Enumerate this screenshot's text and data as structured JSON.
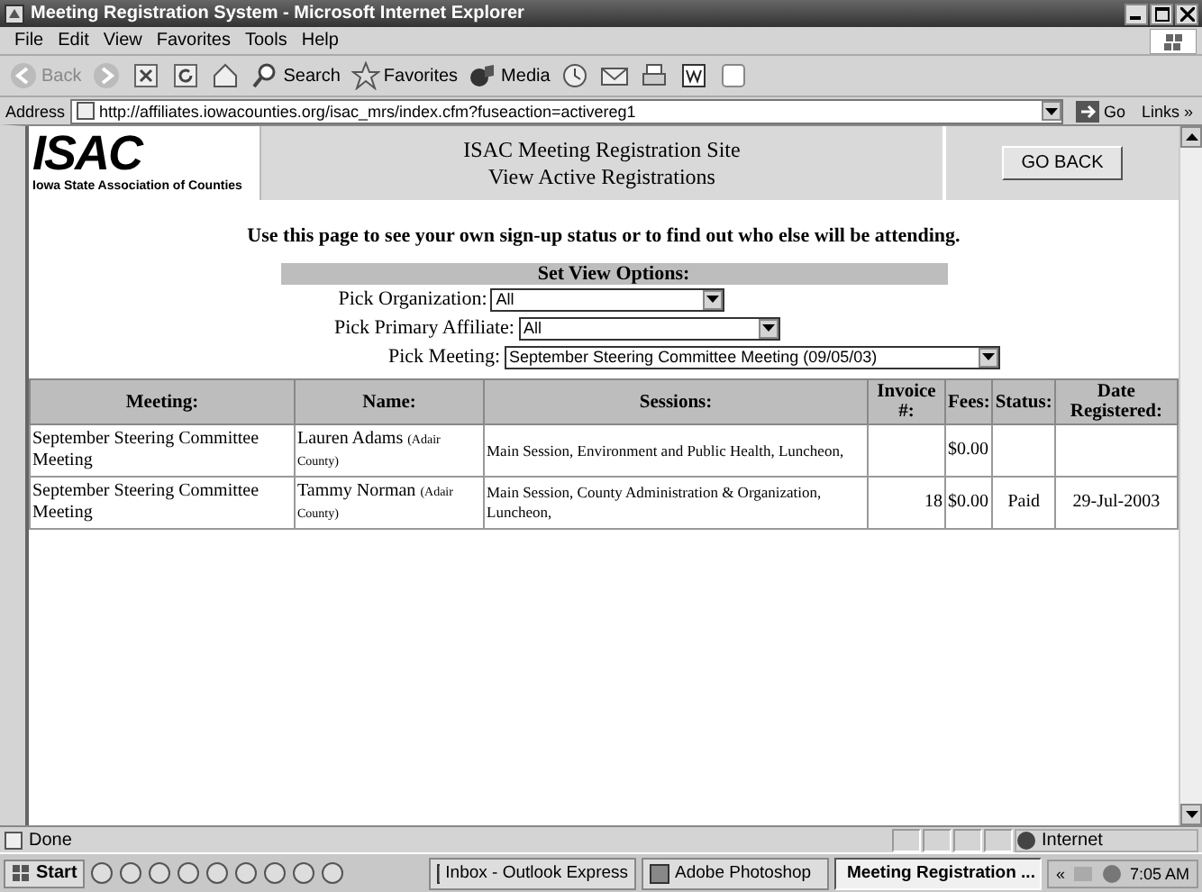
{
  "window": {
    "title": "Meeting Registration System - Microsoft Internet Explorer"
  },
  "menu": [
    "File",
    "Edit",
    "View",
    "Favorites",
    "Tools",
    "Help"
  ],
  "toolbar": [
    {
      "kind": "back",
      "label": "Back",
      "disabled": true
    },
    {
      "kind": "forward",
      "disabled": true
    },
    {
      "kind": "stop"
    },
    {
      "kind": "refresh"
    },
    {
      "kind": "home"
    },
    {
      "kind": "search",
      "label": "Search"
    },
    {
      "kind": "favorites",
      "label": "Favorites"
    },
    {
      "kind": "media",
      "label": "Media"
    },
    {
      "kind": "history"
    },
    {
      "kind": "mail"
    },
    {
      "kind": "print"
    },
    {
      "kind": "edit"
    },
    {
      "kind": "discuss"
    }
  ],
  "address": {
    "label": "Address",
    "value": "http://affiliates.iowacounties.org/isac_mrs/index.cfm?fuseaction=activereg1",
    "go": "Go",
    "links": "Links »"
  },
  "page": {
    "logo": {
      "mark": "ISAC",
      "tagline": "Iowa State Association of Counties"
    },
    "title": [
      "ISAC Meeting Registration Site",
      "View Active Registrations"
    ],
    "back_button": "GO BACK",
    "intro": "Use this page to see your own sign-up status or to find out who else will be attending.",
    "options": {
      "heading": "Set View Options:",
      "fields": [
        {
          "label": "Pick Organization:",
          "value": "All"
        },
        {
          "label": "Pick Primary Affiliate:",
          "value": "All"
        },
        {
          "label": "Pick Meeting:",
          "value": "September Steering Committee Meeting (09/05/03)"
        }
      ]
    },
    "table": {
      "columns": [
        "Meeting:",
        "Name:",
        "Sessions:",
        "Invoice #:",
        "Fees:",
        "Status:",
        "Date Registered:"
      ],
      "rows": [
        {
          "meeting": "September Steering Committee Meeting",
          "name": "Lauren Adams",
          "county": "(Adair County)",
          "sessions": "Main Session, Environment and Public Health, Luncheon,",
          "fees": "$0.00"
        },
        {
          "meeting": "September Steering Committee Meeting",
          "name": "Tammy Norman",
          "county": "(Adair County)",
          "sessions": "Main Session, County Administration & Organization, Luncheon,",
          "invoice": "18",
          "fees": "$0.00",
          "status": "Paid",
          "date": "29-Jul-2003"
        }
      ]
    }
  },
  "status_bar": {
    "text": "Done",
    "zone": "Internet"
  },
  "taskbar": {
    "start": "Start",
    "tasks": [
      {
        "label": "Inbox - Outlook Express",
        "selected": false
      },
      {
        "label": "Adobe Photoshop",
        "selected": false
      },
      {
        "label": "Meeting Registration ...",
        "selected": true
      }
    ],
    "tray_expand": "«",
    "clock": "7:05 AM"
  }
}
